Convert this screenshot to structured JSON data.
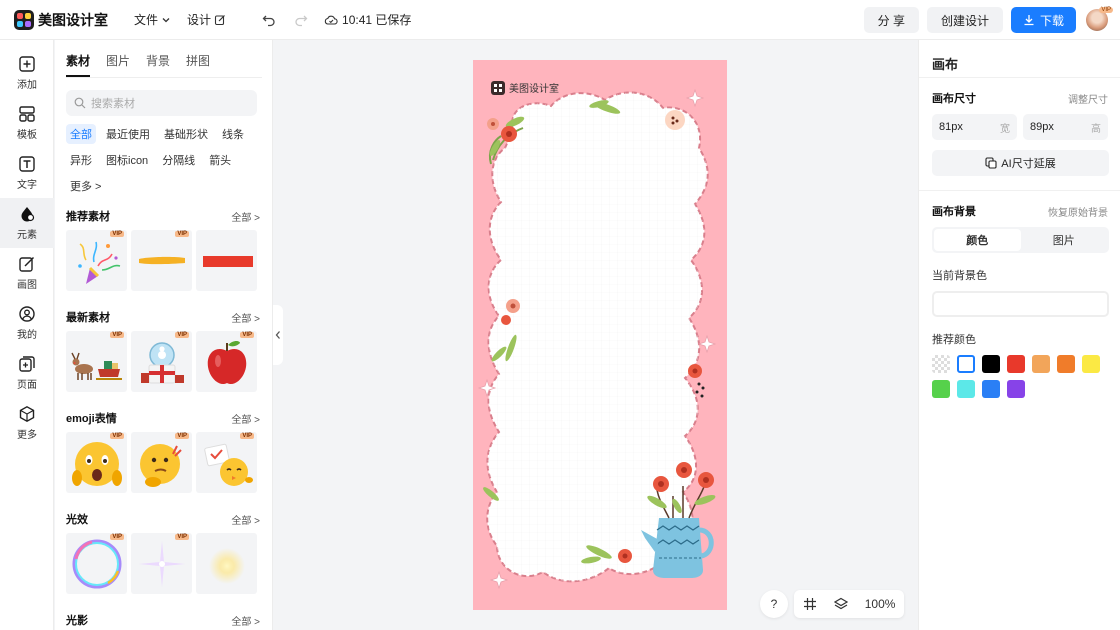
{
  "app": {
    "name": "美图设计室"
  },
  "topbar": {
    "menu": [
      {
        "label": "文件",
        "icon": "chevron-down-icon"
      },
      {
        "label": "设计",
        "icon": "edit-icon"
      }
    ],
    "save_status": "10:41 已保存",
    "share_label": "分 享",
    "create_label": "创建设计",
    "download_label": "下载",
    "avatar_badge": "VIP"
  },
  "rail": {
    "items": [
      {
        "label": "添加",
        "icon": "plus-square-icon"
      },
      {
        "label": "模板",
        "icon": "layout-icon"
      },
      {
        "label": "文字",
        "icon": "text-icon"
      },
      {
        "label": "元素",
        "icon": "shapes-icon"
      },
      {
        "label": "画图",
        "icon": "pencil-icon"
      },
      {
        "label": "我的",
        "icon": "user-icon"
      },
      {
        "label": "页面",
        "icon": "page-add-icon"
      },
      {
        "label": "更多",
        "icon": "cube-icon"
      }
    ]
  },
  "panel": {
    "tabs": [
      "素材",
      "图片",
      "背景",
      "拼图"
    ],
    "search_placeholder": "搜索素材",
    "chips": [
      "全部",
      "最近使用",
      "基础形状",
      "线条",
      "异形",
      "图标icon",
      "分隔线",
      "箭头",
      "更多 >"
    ],
    "all_label": "全部 >",
    "vip_label": "VIP",
    "sections": [
      {
        "title": "推荐素材",
        "items": [
          "party-popper",
          "yellow-brush-stroke",
          "red-bar"
        ]
      },
      {
        "title": "最新素材",
        "items": [
          "reindeer-sleigh",
          "snow-globe-gift",
          "red-apple"
        ]
      },
      {
        "title": "emoji表情",
        "items": [
          "shocked-emoji",
          "thinking-emoji",
          "chick-emoji"
        ]
      },
      {
        "title": "光效",
        "items": [
          "bubble-ring",
          "star-sparkle",
          "soft-glow"
        ]
      },
      {
        "title": "光影",
        "items": []
      }
    ]
  },
  "canvas": {
    "artboard_logo": "美图设计室",
    "bg_color": "#ffb4bd",
    "help_label": "?",
    "zoom": "100%"
  },
  "right": {
    "title": "画布",
    "size_label": "画布尺寸",
    "size_link": "调整尺寸",
    "width_value": "81px",
    "width_unit": "宽",
    "height_value": "89px",
    "height_unit": "高",
    "ai_label": "AI尺寸延展",
    "bg_label": "画布背景",
    "bg_reset": "恢复原始背景",
    "seg_color": "颜色",
    "seg_image": "图片",
    "current_bg": "当前背景色",
    "recommend": "推荐颜色",
    "swatches": [
      "transparent",
      "#ffffff",
      "#000000",
      "#e8392b",
      "#f2a55a",
      "#f07c2a",
      "#fbe944",
      "#56d14b",
      "#5ce8e8",
      "#2a7ff5",
      "#8743e8"
    ]
  }
}
